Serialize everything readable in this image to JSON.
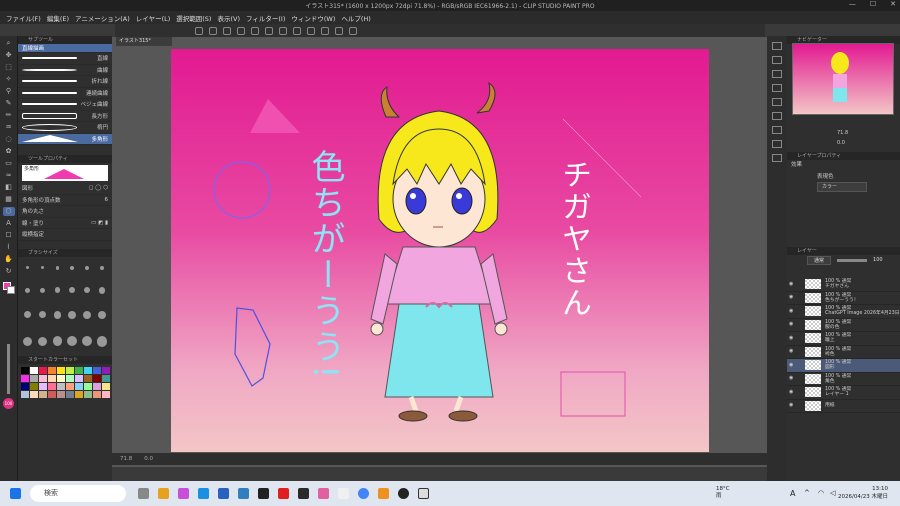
{
  "app": {
    "title": "イラスト315* (1600 x 1200px 72dpi 71.8%) - RGB/sRGB IEC61966-2.1) - CLIP STUDIO PAINT PRO"
  },
  "menu": [
    "ファイル(F)",
    "編集(E)",
    "アニメーション(A)",
    "レイヤー(L)",
    "選択範囲(S)",
    "表示(V)",
    "フィルター(I)",
    "ウィンドウ(W)",
    "ヘルプ(H)"
  ],
  "document_tab": "イラスト315*",
  "sub_tool": {
    "header": "サブツール",
    "group": "直線描画",
    "items": [
      "直線",
      "曲線",
      "折れ線",
      "連続曲線",
      "ベジェ曲線",
      "長方形",
      "楕円",
      "多角形"
    ],
    "selected": "多角形"
  },
  "tool_property": {
    "header": "ツールプロパティ",
    "subheader": "多角形",
    "props": [
      "図形",
      "多角形の頂点数",
      "角の丸さ",
      "線・塗り",
      "縦横指定"
    ],
    "vertex_count": "6"
  },
  "brush_size_header": "ブラシサイズ",
  "color_set": {
    "header": "スタートカラーセット",
    "swatches": [
      "#000000",
      "#ffffff",
      "#e6194b",
      "#f58231",
      "#ffe119",
      "#bfef45",
      "#3cb44b",
      "#42d4f4",
      "#4363d8",
      "#911eb4",
      "#f032e6",
      "#a9a9a9",
      "#fabed4",
      "#ffd8b1",
      "#fffac8",
      "#aaffc3",
      "#dcbeff",
      "#9a6324",
      "#800000",
      "#469990",
      "#000075",
      "#808000",
      "#e6beff",
      "#ff6f91",
      "#c0c0c0",
      "#ffa07a",
      "#87cefa",
      "#98fb98",
      "#dda0dd",
      "#f0e68c",
      "#b0c4de",
      "#ffdab9",
      "#d2b48c",
      "#cd5c5c",
      "#bc8f8f",
      "#708090",
      "#daa520",
      "#8fbc8f",
      "#e9967a",
      "#ffb6c1"
    ]
  },
  "canvas": {
    "text_vertical_left": "色ちがーうう!",
    "text_vertical_right": "チガヤさん",
    "colors": {
      "top": "#e21a91",
      "bottom": "#f3c6c6",
      "triangle": "#f050b0",
      "cyan_text": "#8ee3f5",
      "hair": "#f7e81c",
      "kimono": "#f2a6e0",
      "hakama": "#7fe6ee"
    }
  },
  "status": {
    "zoom": "71.8",
    "position": "0.0"
  },
  "right_panel": {
    "navigator_header": "ナビゲーター",
    "zoom": "71.8",
    "angle": "0.0",
    "layer_property_header": "レイヤープロパティ",
    "effect_label": "効果",
    "display_color_label": "表現色",
    "display_color_value": "カラー",
    "layer_header": "レイヤー",
    "blend_mode": "通常",
    "opacity": "100"
  },
  "layers": [
    {
      "meta": "100 % 通常",
      "name": "チガヤさん"
    },
    {
      "meta": "100 % 通常",
      "name": "色ちがーうう！"
    },
    {
      "meta": "100 % 通常",
      "name": "ChatGPT Image 2026年4月23日"
    },
    {
      "meta": "100 % 通常",
      "name": "服の色"
    },
    {
      "meta": "100 % 通常",
      "name": "瞳上"
    },
    {
      "meta": "100 % 通常",
      "name": "袴色"
    },
    {
      "meta": "100 % 通常",
      "name": "図形"
    },
    {
      "meta": "100 % 通常",
      "name": "角色"
    },
    {
      "meta": "100 % 通常",
      "name": "レイヤー 1"
    },
    {
      "meta": "",
      "name": "用紙"
    }
  ],
  "selected_layer": "図形",
  "taskbar": {
    "search_placeholder": "検索",
    "weather_temp": "18°C",
    "weather_desc": "雨",
    "ime": "A",
    "time": "13:10",
    "date": "2026/04/23 木曜日"
  }
}
